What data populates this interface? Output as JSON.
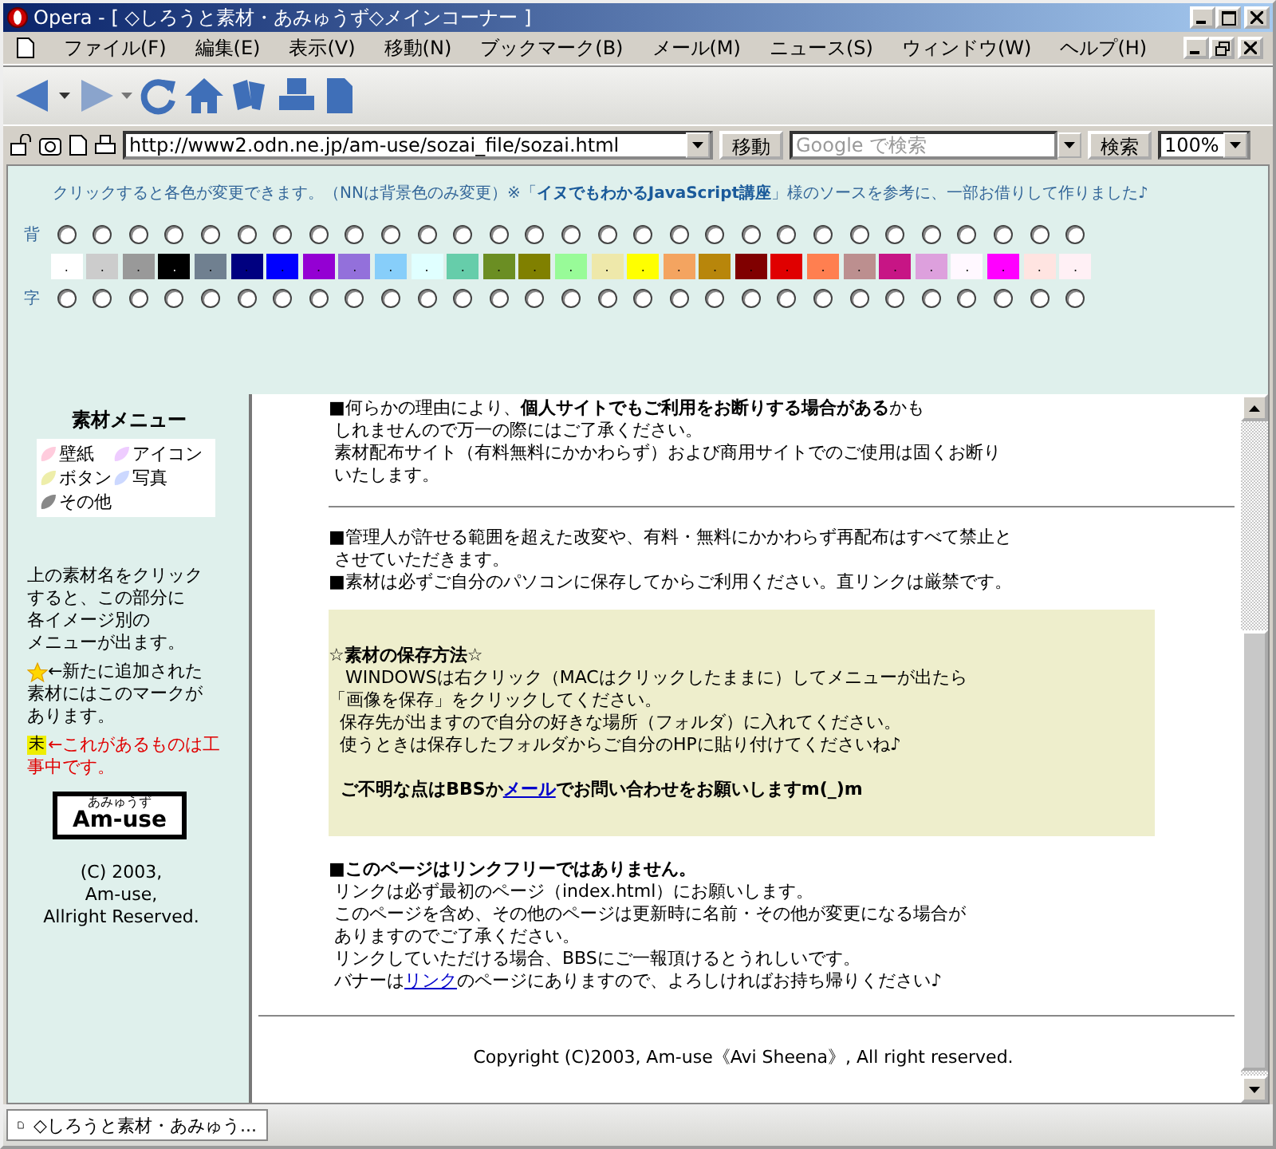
{
  "window": {
    "title": "Opera - [ ◇しろうと素材・あみゅうず◇メインコーナー ]"
  },
  "menu": [
    {
      "label": "ファイル(F)"
    },
    {
      "label": "編集(E)"
    },
    {
      "label": "表示(V)"
    },
    {
      "label": "移動(N)"
    },
    {
      "label": "ブックマーク(B)"
    },
    {
      "label": "メール(M)"
    },
    {
      "label": "ニュース(S)"
    },
    {
      "label": "ウィンドウ(W)"
    },
    {
      "label": "ヘルプ(H)"
    }
  ],
  "address_bar": {
    "url": "http://www2.odn.ne.jp/am-use/sozai_file/sozai.html",
    "go_button": "移動",
    "search_placeholder": "Google で検索",
    "search_button": "検索",
    "zoom": "100%"
  },
  "color_picker": {
    "note": "クリックすると各色が変更できます。（NNは背景色のみ変更）※「**イヌでもわかるJavaScript講座**」様のソースを参考に、一部お借りして作りました♪",
    "background_label": "背",
    "text_label": "字",
    "swatches": [
      {
        "color": "#ffffff",
        "label": ".",
        "bg_selected": false,
        "fg_selected": false
      },
      {
        "color": "#cccccc",
        "label": ".",
        "bg_selected": false,
        "fg_selected": false
      },
      {
        "color": "#999999",
        "label": ".",
        "bg_selected": false,
        "fg_selected": false
      },
      {
        "color": "#000000",
        "label": ".",
        "bg_selected": false,
        "fg_selected": false
      },
      {
        "color": "#708090",
        "label": ".",
        "bg_selected": false,
        "fg_selected": false
      },
      {
        "color": "#000080",
        "label": ".",
        "bg_selected": false,
        "fg_selected": false
      },
      {
        "color": "#0000ff",
        "label": ".",
        "bg_selected": false,
        "fg_selected": false
      },
      {
        "color": "#9400d3",
        "label": ".",
        "bg_selected": false,
        "fg_selected": false
      },
      {
        "color": "#9370db",
        "label": ".",
        "bg_selected": false,
        "fg_selected": false
      },
      {
        "color": "#87cefa",
        "label": ".",
        "bg_selected": false,
        "fg_selected": false
      },
      {
        "color": "#e0ffff",
        "label": ".",
        "bg_selected": false,
        "fg_selected": false
      },
      {
        "color": "#66cdaa",
        "label": ".",
        "bg_selected": false,
        "fg_selected": false
      },
      {
        "color": "#6b8e23",
        "label": ".",
        "bg_selected": false,
        "fg_selected": false
      },
      {
        "color": "#808000",
        "label": ".",
        "bg_selected": false,
        "fg_selected": false
      },
      {
        "color": "#98fb98",
        "label": ".",
        "bg_selected": false,
        "fg_selected": false
      },
      {
        "color": "#eee8aa",
        "label": ".",
        "bg_selected": false,
        "fg_selected": false
      },
      {
        "color": "#ffff00",
        "label": ".",
        "bg_selected": false,
        "fg_selected": false
      },
      {
        "color": "#f4a460",
        "label": ".",
        "bg_selected": false,
        "fg_selected": false
      },
      {
        "color": "#b8860b",
        "label": ".",
        "bg_selected": false,
        "fg_selected": false
      },
      {
        "color": "#800000",
        "label": ".",
        "bg_selected": false,
        "fg_selected": false
      },
      {
        "color": "#e00000",
        "label": ".",
        "bg_selected": false,
        "fg_selected": false
      },
      {
        "color": "#ff7f50",
        "label": ".",
        "bg_selected": false,
        "fg_selected": false
      },
      {
        "color": "#bc8f8f",
        "label": ".",
        "bg_selected": false,
        "fg_selected": false
      },
      {
        "color": "#c71585",
        "label": ".",
        "bg_selected": false,
        "fg_selected": false
      },
      {
        "color": "#dda0dd",
        "label": ".",
        "bg_selected": false,
        "fg_selected": false
      },
      {
        "color": "#fff8ff",
        "label": ".",
        "bg_selected": false,
        "fg_selected": false
      },
      {
        "color": "#ff00ff",
        "label": ".",
        "bg_selected": false,
        "fg_selected": false
      },
      {
        "color": "#ffe4e1",
        "label": ".",
        "bg_selected": false,
        "fg_selected": false
      },
      {
        "color": "#fff0f5",
        "label": ".",
        "bg_selected": false,
        "fg_selected": false
      }
    ]
  },
  "sidebar": {
    "heading": "素材メニュー",
    "menu": [
      {
        "label": "壁紙",
        "color": "#ffccdd"
      },
      {
        "label": "アイコン",
        "color": "#eeccff"
      },
      {
        "label": "ボタン",
        "color": "#eeeeaa"
      },
      {
        "label": "写真",
        "color": "#ccd8ff"
      },
      {
        "label": "その他",
        "color": "#888888"
      }
    ],
    "intro": [
      "上の素材名をクリック",
      "すると、この部分に",
      "各イメージ別の",
      "メニューが出ます。"
    ],
    "new_note": [
      "←新たに追加された",
      "素材にはこのマークが",
      "あります。"
    ],
    "wip_badge": "未",
    "wip_note": [
      "←これがあるものは工",
      "事中です。"
    ],
    "logo": {
      "caption": "あみゅうず",
      "name": "Am-use"
    },
    "copyright": [
      "(C) 2003,",
      "Am-use,",
      "Allright Reserved."
    ]
  },
  "content": {
    "blocks": [
      {
        "kind": "paragraph",
        "lines": [
          {
            "text": "■何らかの理由により、**個人サイトでもご利用をお断りする場合がある**かも",
            "bold": false
          },
          {
            "text": " しれませんので万一の際にはご了承ください。",
            "bold": false
          },
          {
            "text": " 素材配布サイト（有料無料にかかわらず）および商用サイトでのご使用は固くお断り",
            "bold": false
          },
          {
            "text": " いたします。",
            "bold": false
          }
        ]
      },
      {
        "kind": "rule"
      },
      {
        "kind": "paragraph",
        "lines": [
          {
            "text": "■管理人が許せる範囲を超えた改変や、有料・無料にかかわらず再配布はすべて禁止と",
            "bold": false
          },
          {
            "text": " させていただきます。",
            "bold": false
          },
          {
            "text": "■素材は必ずご自分のパソコンに保存してからご利用ください。直リンクは厳禁です。",
            "bold": false
          }
        ]
      },
      {
        "kind": "box",
        "paragraphs": [
          {
            "lines": [
              {
                "text": "☆素材の保存方法☆",
                "bold": true
              },
              {
                "text": "   WINDOWSは右クリック（MACはクリックしたままに）してメニューが出たら",
                "bold": false
              },
              {
                "text": "「画像を保存」をクリックしてください。",
                "bold": false
              },
              {
                "text": "  保存先が出ますので自分の好きな場所（フォルダ）に入れてください。",
                "bold": false
              },
              {
                "text": "  使うときは保存したフォルダからご自分のHPに貼り付けてくださいね♪",
                "bold": false
              }
            ]
          },
          {
            "lines": [
              {
                "parts": [
                  {
                    "text": "  ご不明な点はBBSか"
                  },
                  {
                    "text": "メール",
                    "kind": "link"
                  },
                  {
                    "text": "でお問い合わせをお願いしますm(_)m"
                  }
                ],
                "bold": true
              }
            ]
          }
        ]
      },
      {
        "kind": "paragraph",
        "lines": [
          {
            "text": "■このページはリンクフリーではありません。",
            "bold": true
          },
          {
            "text": " リンクは必ず最初のページ（index.html）にお願いします。",
            "bold": false
          },
          {
            "text": " このページを含め、その他のページは更新時に名前・その他が変更になる場合が",
            "bold": false
          },
          {
            "text": " ありますのでご了承ください。",
            "bold": false
          },
          {
            "text": " リンクしていただける場合、BBSにご一報頂けるとうれしいです。",
            "bold": false
          },
          {
            "parts": [
              {
                "text": " バナーは"
              },
              {
                "text": "リンク",
                "kind": "link"
              },
              {
                "text": "のページにありますので、よろしければお持ち帰りください♪"
              }
            ],
            "bold": false
          }
        ]
      }
    ],
    "footer": "Copyright (C)2003, Am-use《Avi Sheena》, All right reserved."
  },
  "tab": {
    "label": "◇しろうと素材・あみゅう..."
  }
}
